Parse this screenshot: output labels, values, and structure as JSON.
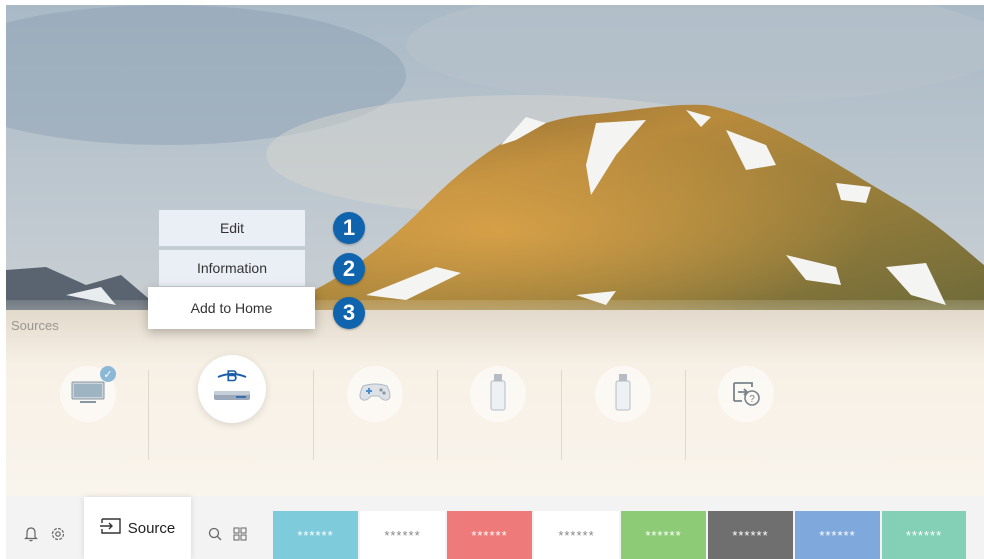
{
  "context_menu": {
    "items": [
      {
        "label": "Edit",
        "badge": "1"
      },
      {
        "label": "Information",
        "badge": "2"
      },
      {
        "label": "Add to Home",
        "badge": "3"
      }
    ]
  },
  "sources": {
    "label": "Sources",
    "items": [
      {
        "icon": "tv-icon",
        "selected": false,
        "connected": true
      },
      {
        "icon": "bluray-player-icon",
        "selected": true,
        "connected": false
      },
      {
        "icon": "game-controller-icon",
        "selected": false,
        "connected": false
      },
      {
        "icon": "usb-drive-icon",
        "selected": false,
        "connected": false
      },
      {
        "icon": "usb-drive-icon",
        "selected": false,
        "connected": false
      },
      {
        "icon": "connection-guide-icon",
        "selected": false,
        "connected": false
      }
    ]
  },
  "bottom_bar": {
    "source_label": "Source",
    "icons": [
      "bell-icon",
      "settings-icon",
      "search-icon",
      "apps-icon"
    ],
    "tiles": [
      {
        "label": "******",
        "color": "#7ecbdb",
        "text_color": "#ffffff"
      },
      {
        "label": "******",
        "color": "#ffffff",
        "text_color": "#888888"
      },
      {
        "label": "******",
        "color": "#ef7a7a",
        "text_color": "#ffffff"
      },
      {
        "label": "******",
        "color": "#ffffff",
        "text_color": "#888888"
      },
      {
        "label": "******",
        "color": "#8ecb77",
        "text_color": "#ffffff"
      },
      {
        "label": "******",
        "color": "#6f6f6f",
        "text_color": "#ffffff"
      },
      {
        "label": "******",
        "color": "#7fa8dc",
        "text_color": "#ffffff"
      },
      {
        "label": "******",
        "color": "#83d0b6",
        "text_color": "#ffffff"
      }
    ]
  },
  "colors": {
    "badge": "#0f64ad",
    "menu_bg": "#ecf0f7",
    "bar_bg": "#f3f3f4"
  }
}
